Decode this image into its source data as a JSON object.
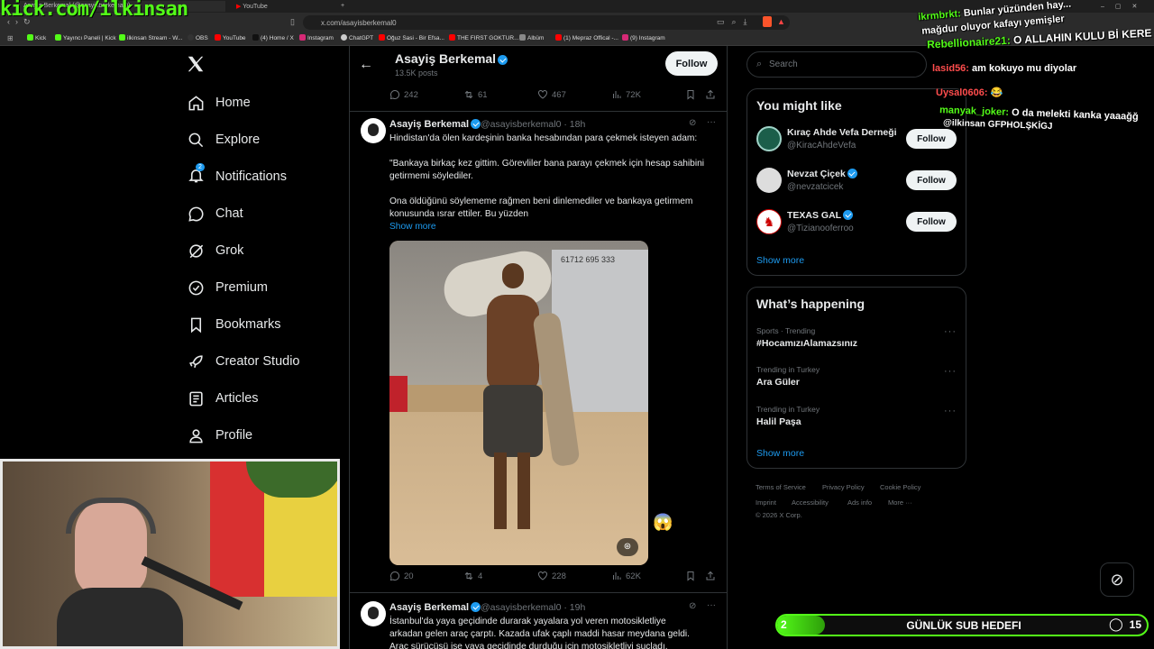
{
  "browser": {
    "tabs": [
      "Asayiş Berkemal (@asayisberkemal0)",
      "YouTube"
    ],
    "url": "x.com/asayisberkemal0",
    "bookmarks": [
      "Kick",
      "Yayıncı Paneli | Kick",
      "ilkinsan Stream - W...",
      "OBS",
      "YouTube",
      "(4) Home / X",
      "Instagram",
      "ChatGPT",
      "Oğuz Sasi - Bir Efsa...",
      "THE FIRST GOKTUR...",
      "Albüm",
      "(1) Mepraz Offical -...",
      "(9) Instagram"
    ]
  },
  "overlay": {
    "kick_url": "kick.com/ilkinsan",
    "chat": [
      {
        "user": "ikrmbrkt:",
        "msg": "Bunlar yüzünden hay...",
        "color": "#53fc18"
      },
      {
        "user": "",
        "msg": "mağdur oluyor kafayı yemişler",
        "color": "#ffffff"
      },
      {
        "user": "Rebellionaire21:",
        "msg": "O ALLAHIN KULU Bİ KERE",
        "color": "#53fc18"
      },
      {
        "user": "lasid56:",
        "msg": "am kokuyo mu diyolar",
        "color": "#ff4d4d"
      },
      {
        "user": "Uysal0606:",
        "msg": "😂",
        "color": "#ff4d4d"
      },
      {
        "user": "manyak_joker:",
        "msg": "O da melekti kanka yaaağğ",
        "color": "#53fc18"
      },
      {
        "user": "",
        "msg": "@ilkinsan GFPHOLŞKİGJ",
        "color": "#ffffff"
      }
    ],
    "sub_goal": {
      "current": "2",
      "label": "GÜNLÜK SUB HEDEFI",
      "target": "15",
      "fraction": 0.13
    }
  },
  "nav": {
    "items": [
      {
        "label": "Home",
        "icon": "home-icon"
      },
      {
        "label": "Explore",
        "icon": "search-icon"
      },
      {
        "label": "Notifications",
        "icon": "bell-icon",
        "badge": "2"
      },
      {
        "label": "Chat",
        "icon": "chat-icon"
      },
      {
        "label": "Grok",
        "icon": "grok-icon"
      },
      {
        "label": "Premium",
        "icon": "premium-icon"
      },
      {
        "label": "Bookmarks",
        "icon": "bookmark-icon"
      },
      {
        "label": "Creator Studio",
        "icon": "rocket-icon"
      },
      {
        "label": "Articles",
        "icon": "articles-icon"
      },
      {
        "label": "Profile",
        "icon": "profile-icon"
      }
    ]
  },
  "profile_header": {
    "name": "Asayiş Berkemal",
    "posts": "13.5K posts",
    "follow": "Follow"
  },
  "top_stats": {
    "replies": "242",
    "reposts": "61",
    "likes": "467",
    "views": "72K"
  },
  "tweet1": {
    "name": "Asayiş Berkemal",
    "handle": "@asayisberkemal0 · 18h",
    "line1": "Hindistan'da ölen kardeşinin banka hesabından para çekmek isteyen adam:",
    "para2": "\"Bankaya birkaç kez gittim. Görevliler bana parayı çekmek için hesap sahibini getirmemi söylediler.",
    "para3": "Ona öldüğünü söylememe rağmen beni dinlemediler ve bankaya getirmem konusunda ısrar ettiler. Bu yüzden",
    "show_more": "Show more",
    "image_sign": "61712 695 333",
    "stats": {
      "replies": "20",
      "reposts": "4",
      "likes": "228",
      "views": "62K"
    }
  },
  "tweet2": {
    "name": "Asayiş Berkemal",
    "handle": "@asayisberkemal0 · 19h",
    "line1": "İstanbul'da yaya geçidinde durarak yayalara yol veren motosikletliye",
    "line2": "arkadan gelen araç çarptı. Kazada ufak çaplı maddi hasar meydana geldi.",
    "line3": "Araç sürücüsü ise yaya geçidinde durduğu için motosikletliyi suçladı."
  },
  "search": {
    "placeholder": "Search"
  },
  "who_to_follow": {
    "title": "You might like",
    "accounts": [
      {
        "name": "Kıraç Ahde Vefa Derneği",
        "handle": "@KiracAhdeVefa",
        "verified": false,
        "follow": "Follow"
      },
      {
        "name": "Nevzat Çiçek",
        "handle": "@nevzatcicek",
        "verified": true,
        "follow": "Follow"
      },
      {
        "name": "TEXAS GAL",
        "handle": "@Tizianooferroo",
        "verified": true,
        "follow": "Follow"
      }
    ],
    "show_more": "Show more"
  },
  "trends": {
    "title": "What’s happening",
    "items": [
      {
        "category": "Sports · Trending",
        "name": "#HocamızıAlamazsınız"
      },
      {
        "category": "Trending in Turkey",
        "name": "Ara Güler"
      },
      {
        "category": "Trending in Turkey",
        "name": "Halil Paşa"
      }
    ],
    "show_more": "Show more"
  },
  "footer": {
    "links": [
      "Terms of Service",
      "Privacy Policy",
      "Cookie Policy",
      "Imprint",
      "Accessibility",
      "Ads info",
      "More ···"
    ],
    "copyright": "© 2026 X Corp."
  },
  "colors": {
    "accent": "#1d9bf0",
    "kick_green": "#53fc18",
    "bg": "#000000",
    "border": "#2f3336"
  }
}
